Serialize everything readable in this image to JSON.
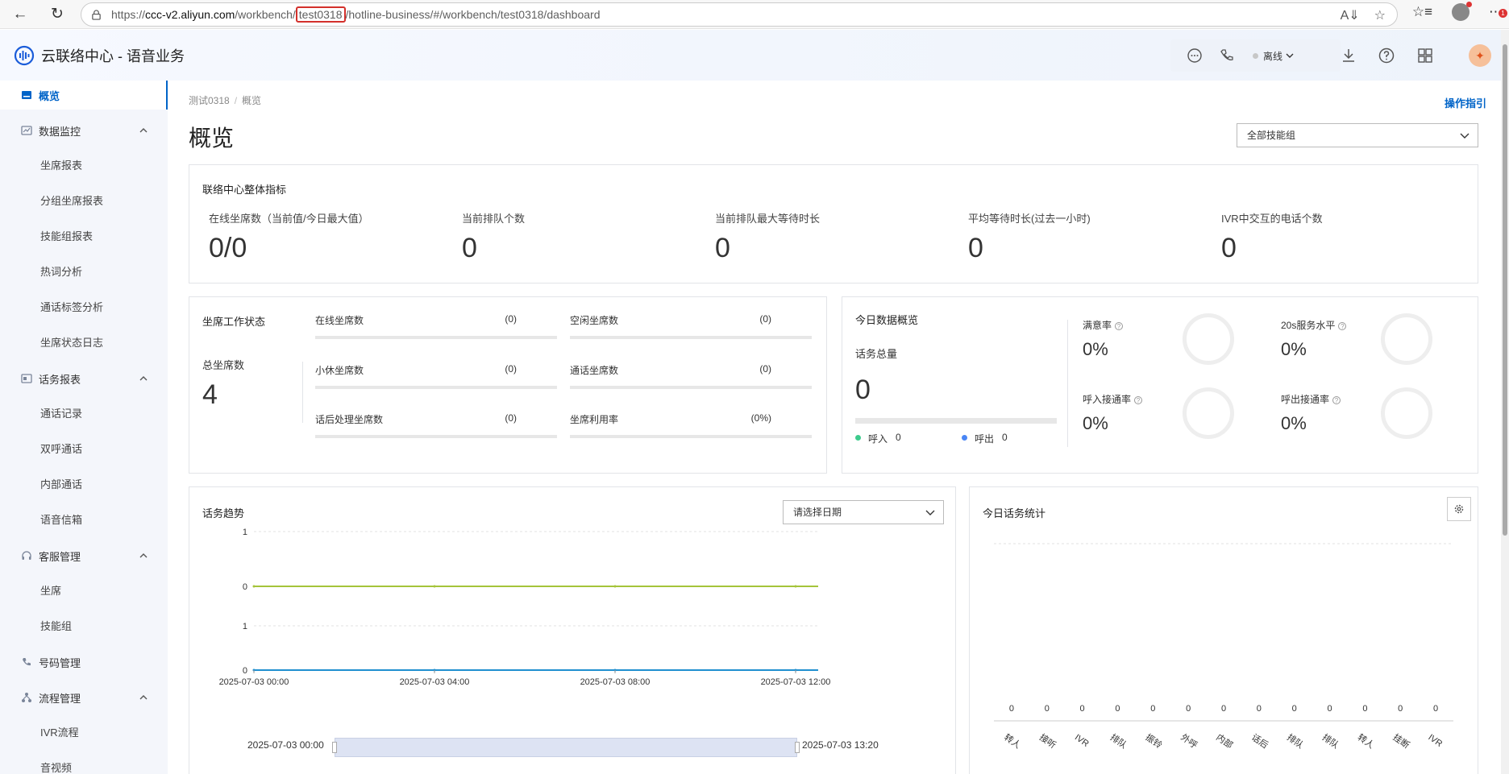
{
  "browser": {
    "url_prefix": "https://",
    "url_host": "ccc-v2.aliyun.com",
    "url_mid1": "/workbench/",
    "url_highlight": "test0318",
    "url_mid2": "/hotline-business/#/workbench/test0318/dashboard",
    "notification_count": "1"
  },
  "header": {
    "title": "云联络中心 - 语音业务",
    "status": "离线"
  },
  "sidebar": {
    "items": [
      {
        "label": "概览",
        "icon": "dashboard-icon"
      },
      {
        "label": "数据监控",
        "icon": "monitor-icon"
      },
      {
        "label": "坐席报表"
      },
      {
        "label": "分组坐席报表"
      },
      {
        "label": "技能组报表"
      },
      {
        "label": "热词分析"
      },
      {
        "label": "通话标签分析"
      },
      {
        "label": "坐席状态日志"
      },
      {
        "label": "话务报表",
        "icon": "report-icon"
      },
      {
        "label": "通话记录"
      },
      {
        "label": "双呼通话"
      },
      {
        "label": "内部通话"
      },
      {
        "label": "语音信箱"
      },
      {
        "label": "客服管理",
        "icon": "headset-icon"
      },
      {
        "label": "坐席"
      },
      {
        "label": "技能组"
      },
      {
        "label": "号码管理",
        "icon": "phone-icon"
      },
      {
        "label": "流程管理",
        "icon": "flow-icon"
      },
      {
        "label": "IVR流程"
      },
      {
        "label": "音视频"
      }
    ]
  },
  "breadcrumb": {
    "root": "测试0318",
    "sep": "/",
    "current": "概览"
  },
  "op_guide": "操作指引",
  "page_title": "概览",
  "skill_group_select": "全部技能组",
  "overall": {
    "title": "联络中心整体指标",
    "metrics": [
      {
        "label": "在线坐席数（当前值/今日最大值）",
        "value": "0/0"
      },
      {
        "label": "当前排队个数",
        "value": "0"
      },
      {
        "label": "当前排队最大等待时长",
        "value": "0"
      },
      {
        "label": "平均等待时长(过去一小时)",
        "value": "0"
      },
      {
        "label": "IVR中交互的电话个数",
        "value": "0"
      }
    ]
  },
  "agent_status": {
    "title": "坐席工作状态",
    "total_label": "总坐席数",
    "total_value": "4",
    "items": [
      {
        "label": "在线坐席数",
        "value": "(0)"
      },
      {
        "label": "空闲坐席数",
        "value": "(0)"
      },
      {
        "label": "小休坐席数",
        "value": "(0)"
      },
      {
        "label": "通话坐席数",
        "value": "(0)"
      },
      {
        "label": "话后处理坐席数",
        "value": "(0)"
      },
      {
        "label": "坐席利用率",
        "value": "(0%)"
      }
    ]
  },
  "today_overview": {
    "title": "今日数据概览",
    "total_label": "话务总量",
    "total_value": "0",
    "inbound_label": "呼入",
    "inbound_value": "0",
    "outbound_label": "呼出",
    "outbound_value": "0",
    "inbound_color": "#3ecb8d",
    "outbound_color": "#4a86f5",
    "rates": [
      {
        "label": "满意率",
        "value": "0%"
      },
      {
        "label": "20s服务水平",
        "value": "0%"
      },
      {
        "label": "呼入接通率",
        "value": "0%"
      },
      {
        "label": "呼出接通率",
        "value": "0%"
      }
    ]
  },
  "trend": {
    "title": "话务趋势",
    "date_placeholder": "请选择日期",
    "range_start": "2025-07-03 00:00",
    "range_end": "2025-07-03 13:20"
  },
  "chart_data": {
    "type": "line",
    "x": [
      "2025-07-03 00:00",
      "2025-07-03 04:00",
      "2025-07-03 08:00",
      "2025-07-03 12:00"
    ],
    "y_tick_labels_upper": [
      "1",
      "0"
    ],
    "y_tick_labels_lower": [
      "1",
      "0"
    ],
    "series": [
      {
        "values": [
          0,
          0,
          0,
          0
        ],
        "color": "#a5c43a"
      },
      {
        "values": [
          0,
          0,
          0,
          0
        ],
        "color": "#1f8fcf"
      }
    ],
    "grid": true
  },
  "today_stats": {
    "title": "今日话务统计",
    "bar_values": [
      "0",
      "0",
      "0",
      "0",
      "0",
      "0",
      "0",
      "0",
      "0",
      "0",
      "0",
      "0",
      "0"
    ],
    "bar_labels": [
      "转人",
      "接听",
      "IVR",
      "排队",
      "振铃",
      "外呼",
      "内部",
      "话后",
      "排队",
      "排队",
      "转人",
      "挂断",
      "IVR"
    ]
  }
}
